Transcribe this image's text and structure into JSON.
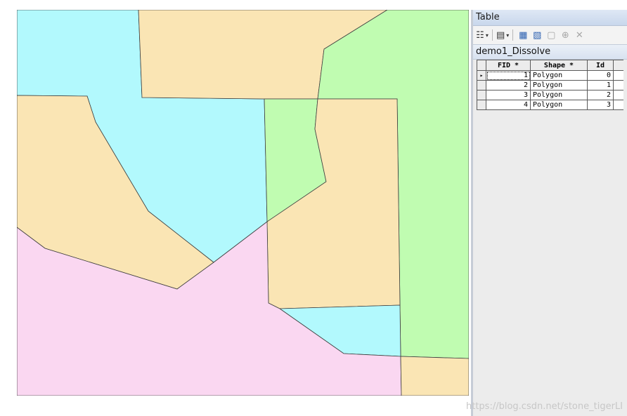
{
  "panel": {
    "title": "Table",
    "table_name": "demo1_Dissolve"
  },
  "toolbar": {
    "icons": [
      "table-options-icon",
      "related-tables-icon",
      "select-by-attributes-icon",
      "switch-selection-icon",
      "clear-selection-icon",
      "zoom-to-selected-icon",
      "delete-selected-icon"
    ],
    "caret": "▾"
  },
  "grid": {
    "headers": [
      "FID *",
      "Shape *",
      "Id"
    ],
    "rows": [
      {
        "fid": "1",
        "shape": "Polygon",
        "id": "0"
      },
      {
        "fid": "2",
        "shape": "Polygon",
        "id": "1"
      },
      {
        "fid": "3",
        "shape": "Polygon",
        "id": "2"
      },
      {
        "fid": "4",
        "shape": "Polygon",
        "id": "3"
      }
    ],
    "active_row_marker": "▸"
  },
  "map": {
    "polygon_colors": {
      "cyan": "#b2f9fd",
      "tan": "#fae5b4",
      "green": "#c0fcb1",
      "pink": "#fad7f1",
      "outline": "#3f3f3f"
    }
  },
  "watermark": "https://blog.csdn.net/stone_tigerLI"
}
